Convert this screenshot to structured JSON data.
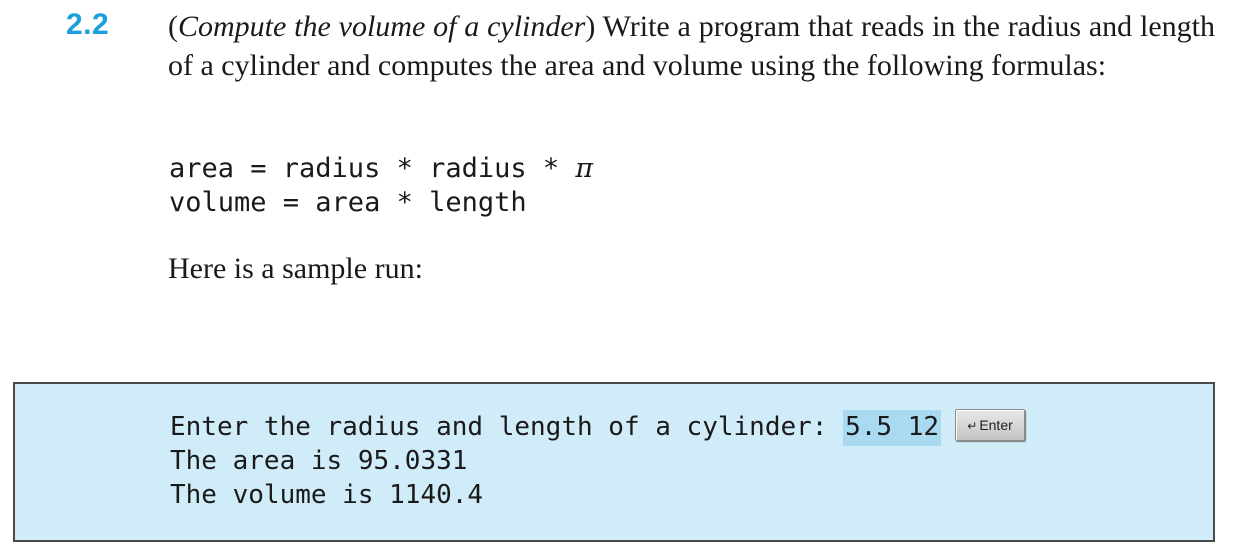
{
  "exercise": {
    "number": "2.2",
    "topic": "Compute the volume of a cylinder",
    "open_paren": "(",
    "close_paren": ")",
    "description": " Write a program that reads in the radius and length of a cylinder and computes the area and volume using the following formulas:"
  },
  "formulas": {
    "line1_text": "area = radius * radius * ",
    "line1_symbol": "π",
    "line2_text": "volume = area * length"
  },
  "sample_intro": "Here is a sample run:",
  "console": {
    "prompt": "Enter the radius and length of a cylinder: ",
    "user_input": "5.5 12",
    "enter_key_label": "Enter",
    "enter_key_icon": "↵",
    "output_area": "The area is 95.0331",
    "output_volume": "The volume is 1140.4"
  }
}
